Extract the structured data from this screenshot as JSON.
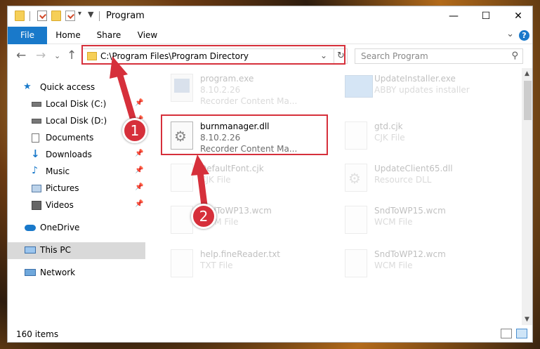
{
  "window": {
    "title": "Program",
    "controls": {
      "minimize": "—",
      "maximize": "☐",
      "close": "✕"
    }
  },
  "ribbon": {
    "tabs": [
      "File",
      "Home",
      "Share",
      "View"
    ],
    "help": "?"
  },
  "address": {
    "path": "C:\\Program Files\\Program Directory",
    "search_placeholder": "Search Program"
  },
  "sidebar": {
    "items": [
      {
        "label": "Quick access",
        "icon": "star-icon"
      },
      {
        "label": "Local Disk (C:)",
        "icon": "drive-icon",
        "pinned": true
      },
      {
        "label": "Local Disk (D:)",
        "icon": "drive-icon",
        "pinned": true
      },
      {
        "label": "Documents",
        "icon": "documents-icon",
        "pinned": true
      },
      {
        "label": "Downloads",
        "icon": "download-icon",
        "pinned": true
      },
      {
        "label": "Music",
        "icon": "music-icon",
        "pinned": true
      },
      {
        "label": "Pictures",
        "icon": "pictures-icon",
        "pinned": true
      },
      {
        "label": "Videos",
        "icon": "videos-icon",
        "pinned": true
      },
      {
        "label": "OneDrive",
        "icon": "cloud-icon"
      },
      {
        "label": "This PC",
        "icon": "computer-icon",
        "selected": true
      },
      {
        "label": "Network",
        "icon": "network-icon"
      }
    ]
  },
  "files": [
    {
      "name": "program.exe",
      "meta1": "8.10.2.26",
      "meta2": "Recorder Content Ma...",
      "icon": "exe-icon"
    },
    {
      "name": "UpdateInstaller.exe",
      "meta1": "ABBY updates installer",
      "meta2": "",
      "icon": "installer-icon"
    },
    {
      "name": "burnmanager.dll",
      "meta1": "8.10.2.26",
      "meta2": "Recorder Content Ma...",
      "icon": "dll-gear-icon",
      "highlighted": true
    },
    {
      "name": "gtd.cjk",
      "meta1": "CJK File",
      "meta2": "",
      "icon": "blank-file-icon"
    },
    {
      "name": "DefaultFont.cjk",
      "meta1": "CJK File",
      "meta2": "",
      "icon": "blank-file-icon"
    },
    {
      "name": "UpdateClient65.dll",
      "meta1": "Resource DLL",
      "meta2": "",
      "icon": "dll-gear-icon"
    },
    {
      "name": "SndToWP13.wcm",
      "meta1": "WCM File",
      "meta2": "",
      "icon": "blank-file-icon"
    },
    {
      "name": "SndToWP15.wcm",
      "meta1": "WCM File",
      "meta2": "",
      "icon": "blank-file-icon"
    },
    {
      "name": "help.fineReader.txt",
      "meta1": "TXT File",
      "meta2": "",
      "icon": "blank-file-icon"
    },
    {
      "name": "SndToWP12.wcm",
      "meta1": "WCM File",
      "meta2": "",
      "icon": "blank-file-icon"
    }
  ],
  "status": {
    "item_count": "160 items"
  },
  "callouts": {
    "one": "1",
    "two": "2"
  },
  "colors": {
    "accent": "#1979ca",
    "highlight": "#d6303b",
    "selected": "#d9d9d9"
  }
}
